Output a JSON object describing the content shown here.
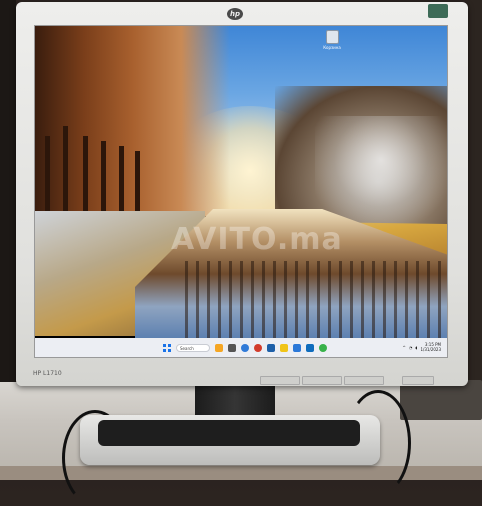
{
  "monitor": {
    "brand_logo": "hp",
    "model_label": "HP L1710",
    "badge_label": "",
    "buttons": [
      "menu-button",
      "minus-button",
      "plus-button",
      "auto-button"
    ]
  },
  "desktop": {
    "icons": [
      {
        "name": "recycle-bin-icon",
        "label": "Корзина"
      }
    ],
    "watermark": "AVITO.ma"
  },
  "taskbar": {
    "search_placeholder": "Search",
    "time": "3:15 PM",
    "date": "1/31/2023"
  },
  "colors": {
    "sky": "#3f86d6",
    "taskbar": "#eceef3",
    "bezel": "#e6e6e3"
  }
}
